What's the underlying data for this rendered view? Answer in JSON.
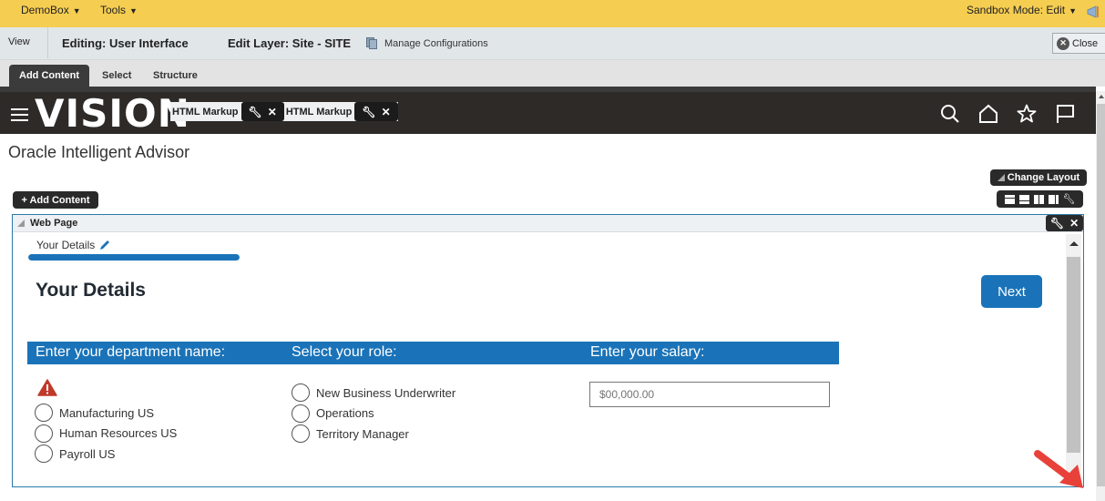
{
  "topbar": {
    "menus": [
      {
        "label": "DemoBox"
      },
      {
        "label": "Tools"
      }
    ],
    "sandbox_mode": "Sandbox Mode: Edit"
  },
  "editbar": {
    "view_label": "View",
    "editing": "Editing: User Interface",
    "edit_layer": "Edit Layer: Site - SITE",
    "manage_configurations": "Manage Configurations",
    "close_label": "Close"
  },
  "tabs": [
    {
      "label": "Add Content",
      "active": true
    },
    {
      "label": "Select",
      "active": false
    },
    {
      "label": "Structure",
      "active": false
    }
  ],
  "navbar": {
    "logo": "VISION",
    "widgets": [
      {
        "label": "HTML Markup"
      },
      {
        "label": "HTML Markup"
      }
    ],
    "icons": [
      "search-icon",
      "home-icon",
      "star-icon",
      "flag-icon",
      "bell-icon"
    ]
  },
  "page": {
    "title": "Oracle Intelligent Advisor",
    "add_content_label": "+ Add Content",
    "change_layout_label": "Change Layout"
  },
  "webpage": {
    "header_label": "Web Page",
    "step_label": "Your Details",
    "progress_fraction": 1.0,
    "screen_title": "Your Details",
    "next_label": "Next",
    "questions": [
      {
        "label": "Enter your department name:"
      },
      {
        "label": "Select your role:"
      },
      {
        "label": "Enter your salary:"
      }
    ],
    "departments": [
      "Manufacturing US",
      "Human Resources US",
      "Payroll US"
    ],
    "roles": [
      "New Business Underwriter",
      "Operations",
      "Territory Manager"
    ],
    "salary_placeholder": "$00,000.00"
  },
  "colors": {
    "topbar": "#f5cd51",
    "brand_blue": "#1a73b8",
    "navbar": "#2d2a28",
    "warning_red": "#c0392b",
    "annotation_arrow": "#e8413a"
  }
}
